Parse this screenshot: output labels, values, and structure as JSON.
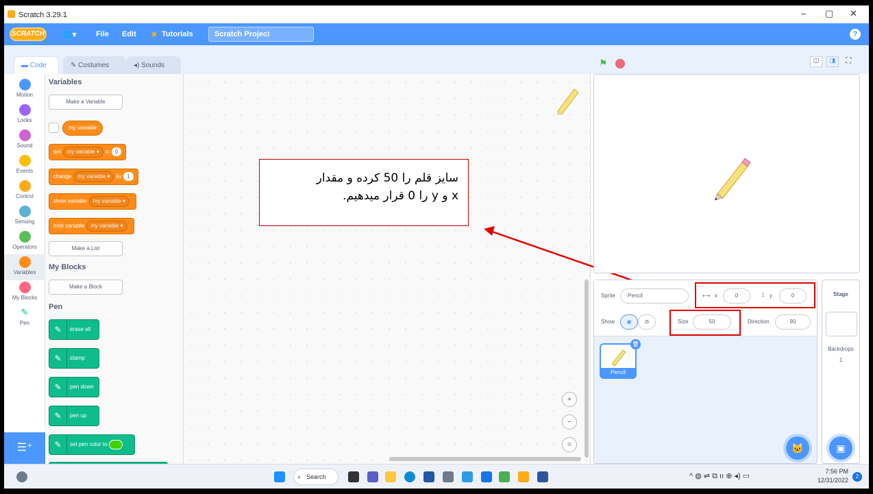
{
  "window": {
    "title": "Scratch 3.29.1",
    "min": "–",
    "max": "▢",
    "close": "✕"
  },
  "menu": {
    "logo": "SCRATCH",
    "globe": "🌐▾",
    "file": "File",
    "edit": "Edit",
    "tutorials": "Tutorials",
    "project": "Scratch Project",
    "help": "?"
  },
  "tabs": {
    "code": "Code",
    "costumes": "Costumes",
    "sounds": "Sounds"
  },
  "categories": [
    {
      "label": "Motion",
      "color": "#4c97ff"
    },
    {
      "label": "Looks",
      "color": "#9966ff"
    },
    {
      "label": "Sound",
      "color": "#cf63cf"
    },
    {
      "label": "Events",
      "color": "#ffbf00"
    },
    {
      "label": "Control",
      "color": "#ffab19"
    },
    {
      "label": "Sensing",
      "color": "#5cb1d6"
    },
    {
      "label": "Operators",
      "color": "#59c059"
    },
    {
      "label": "Variables",
      "color": "#ff8c1a"
    },
    {
      "label": "My Blocks",
      "color": "#ff6680"
    },
    {
      "label": "Pen",
      "color": "#0fbd8c"
    }
  ],
  "palette": {
    "variables_title": "Variables",
    "make_variable": "Make a Variable",
    "my_variable": "my variable",
    "set": {
      "a": "set",
      "dd": "my variable ▾",
      "b": "to",
      "val": "0"
    },
    "change": {
      "a": "change",
      "dd": "my variable ▾",
      "b": "by",
      "val": "1"
    },
    "show": {
      "a": "show variable",
      "dd": "my variable ▾"
    },
    "hide": {
      "a": "hide variable",
      "dd": "my variable ▾"
    },
    "make_list": "Make a List",
    "myblocks_title": "My Blocks",
    "make_block": "Make a Block",
    "pen_title": "Pen",
    "pen_blocks": [
      "erase all",
      "stamp",
      "pen down",
      "pen up",
      "set pen color to"
    ]
  },
  "annotation": {
    "line1": "سایز قلم را 50 کرده و مقدار",
    "line2": "x و y را 0 قرار میدهیم."
  },
  "zoom": {
    "in": "+",
    "out": "−",
    "reset": "="
  },
  "sprite": {
    "label": "Sprite",
    "name": "Pencil",
    "x_label": "x",
    "x": "0",
    "y_label": "y",
    "y": "0",
    "show": "Show",
    "size_label": "Size",
    "size": "50",
    "direction_label": "Direction",
    "direction": "90",
    "thumb_name": "Pencil"
  },
  "stage": {
    "title": "Stage",
    "backdrops_label": "Backdrops",
    "backdrops": "1"
  },
  "taskbar": {
    "search": "Search",
    "time": "7:56 PM",
    "date": "12/31/2022",
    "badge": "2"
  },
  "colors": {
    "accent": "#4c97ff",
    "annotation_border": "#e00000"
  }
}
